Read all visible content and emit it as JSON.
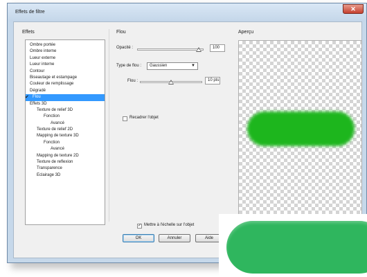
{
  "window": {
    "title": "Effets de filtre",
    "close_glyph": "✕"
  },
  "effects_panel": {
    "label": "Effets",
    "items": [
      {
        "label": "Ombre portée",
        "indent": 0,
        "selected": false,
        "checked": false
      },
      {
        "label": "Ombre interne",
        "indent": 0,
        "selected": false,
        "checked": false
      },
      {
        "label": "Lueur externe",
        "indent": 0,
        "selected": false,
        "checked": false
      },
      {
        "label": "Lueur interne",
        "indent": 0,
        "selected": false,
        "checked": false
      },
      {
        "label": "Contour",
        "indent": 0,
        "selected": false,
        "checked": false
      },
      {
        "label": "Biseautage et estampage",
        "indent": 0,
        "selected": false,
        "checked": false
      },
      {
        "label": "Couleur de remplissage",
        "indent": 0,
        "selected": false,
        "checked": false
      },
      {
        "label": "Dégradé",
        "indent": 0,
        "selected": false,
        "checked": false
      },
      {
        "label": "Flou",
        "indent": 0,
        "selected": true,
        "checked": true
      },
      {
        "label": "Effets 3D",
        "indent": 0,
        "selected": false,
        "checked": false
      },
      {
        "label": "Texture de relief 3D",
        "indent": 1,
        "selected": false,
        "checked": false
      },
      {
        "label": "Fonction",
        "indent": 2,
        "selected": false,
        "checked": false
      },
      {
        "label": "Avancé",
        "indent": 3,
        "selected": false,
        "checked": false
      },
      {
        "label": "Texture de relief 2D",
        "indent": 1,
        "selected": false,
        "checked": false
      },
      {
        "label": "Mapping de texture 3D",
        "indent": 1,
        "selected": false,
        "checked": false
      },
      {
        "label": "Fonction",
        "indent": 2,
        "selected": false,
        "checked": false
      },
      {
        "label": "Avancé",
        "indent": 3,
        "selected": false,
        "checked": false
      },
      {
        "label": "Mapping de texture 2D",
        "indent": 1,
        "selected": false,
        "checked": false
      },
      {
        "label": "Texture de reflexion",
        "indent": 1,
        "selected": false,
        "checked": false
      },
      {
        "label": "Transparence",
        "indent": 1,
        "selected": false,
        "checked": false
      },
      {
        "label": "Eclairage 3D",
        "indent": 1,
        "selected": false,
        "checked": false
      }
    ]
  },
  "flou_panel": {
    "label": "Flou",
    "opacity": {
      "label": "Opacité :",
      "value": "100",
      "slider_fraction": 0.93
    },
    "blur_type": {
      "label": "Type de flou :",
      "selected": "Gaussien",
      "arrow": "▼"
    },
    "blur": {
      "label": "Flou :",
      "value": "10 pts",
      "slider_fraction": 0.5
    },
    "recadrer": {
      "label": "Recadrer l'objet",
      "checked": false
    }
  },
  "preview": {
    "label": "Aperçu",
    "shape_color": "#1db61d"
  },
  "footer": {
    "scale_checkbox": {
      "label": "Mettre à l'échelle sur l'objet",
      "checked": true,
      "glyph": "✓"
    },
    "ok_label": "OK",
    "cancel_label": "Annuler",
    "help_label": "Aide"
  },
  "overlay": {
    "shape_color": "#2fb65e"
  }
}
